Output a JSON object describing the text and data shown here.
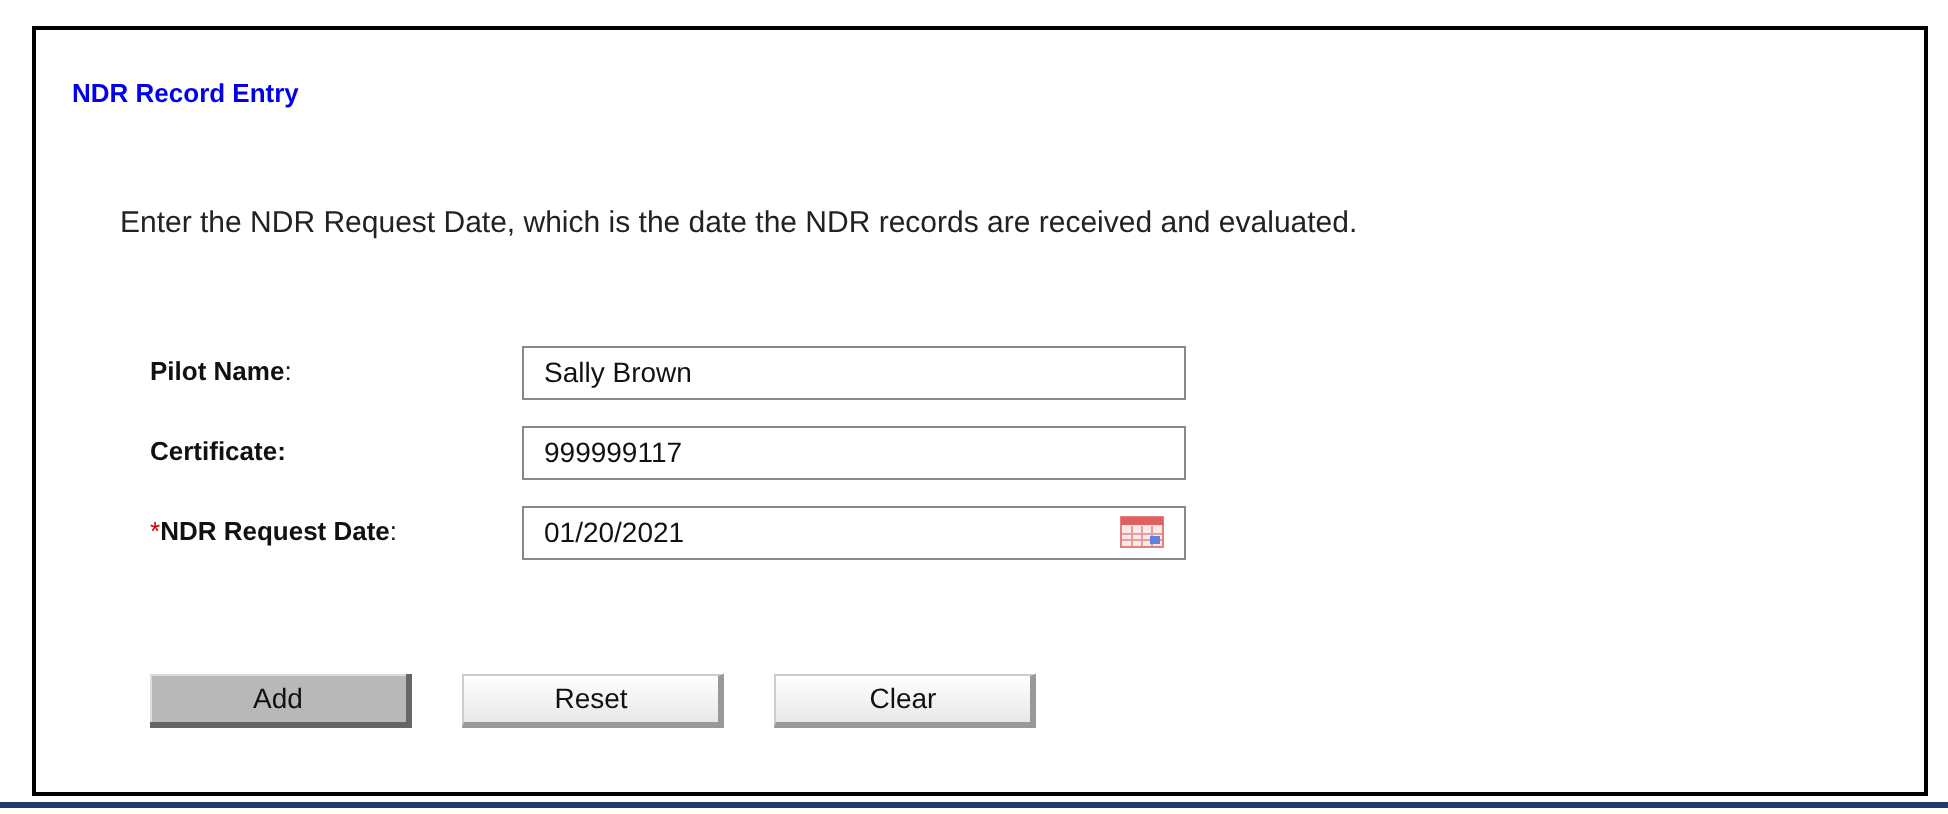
{
  "title": "NDR Record Entry",
  "instruction": "Enter the NDR Request Date, which is the date the NDR records are received and evaluated.",
  "fields": [
    {
      "label": "Pilot Name",
      "colon": ":",
      "kind": "text",
      "value": "Sally Brown"
    },
    {
      "label": "Certificate:",
      "kind": "text",
      "value": "999999117"
    },
    {
      "required_mark": "*",
      "label": "NDR Request Date",
      "colon": ":",
      "kind": "date",
      "value": "01/20/2021"
    }
  ],
  "buttons": [
    {
      "label": "Add",
      "kind": "primary"
    },
    {
      "label": "Reset",
      "kind": "secondary"
    },
    {
      "label": "Clear",
      "kind": "secondary"
    }
  ]
}
